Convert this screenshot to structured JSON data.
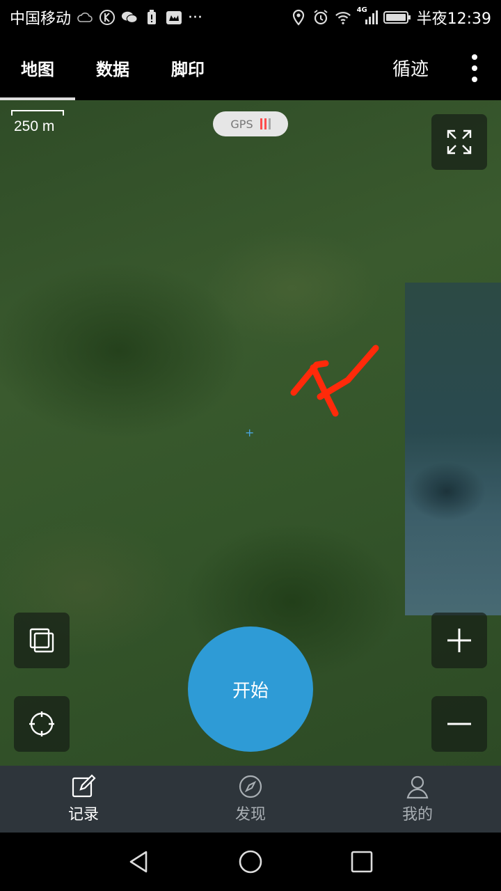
{
  "status_bar": {
    "carrier": "中国移动",
    "network": "4G",
    "time": "半夜12:39",
    "left_icons": [
      "cloud-icon",
      "k-circle-icon",
      "wechat-icon",
      "battery-small-icon",
      "cat-icon",
      "more-dots-icon"
    ],
    "right_icons": [
      "location-icon",
      "alarm-icon",
      "wifi-icon",
      "signal-icon",
      "battery-icon"
    ],
    "more_glyph": "···"
  },
  "top_tabs": {
    "items": [
      {
        "label": "地图",
        "active": true
      },
      {
        "label": "数据",
        "active": false
      },
      {
        "label": "脚印",
        "active": false
      }
    ],
    "trail_label": "循迹",
    "menu_icon": "more-vertical-icon"
  },
  "map": {
    "scale_label": "250 m",
    "gps_label": "GPS",
    "gps_signal_colors": [
      "#ff4c4c",
      "#ff4c4c",
      "#a8a8a8"
    ],
    "crosshair_glyph": "+",
    "annotation_color": "#ff2a0a",
    "start_label": "开始",
    "start_color": "#2e9bd6"
  },
  "bottom_nav": {
    "items": [
      {
        "label": "记录",
        "icon": "edit-icon",
        "active": true
      },
      {
        "label": "发现",
        "icon": "compass-icon",
        "active": false
      },
      {
        "label": "我的",
        "icon": "user-icon",
        "active": false
      }
    ]
  }
}
